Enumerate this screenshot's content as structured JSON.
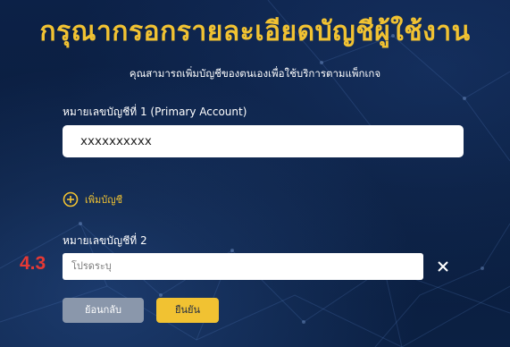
{
  "form": {
    "title": "กรุณากรอกรายละเอียดบัญชีผู้ใช้งาน",
    "subtitle": "คุณสามารถเพิ่มบัญชีของตนเองเพื่อใช้บริการตามแพ็กเกจ",
    "account1": {
      "label": "หมายเลขบัญชีที่ 1 (Primary Account)",
      "value": "xxxxxxxxxx"
    },
    "add_account_label": "เพิ่มบัญชี",
    "account2": {
      "step_marker": "4.3",
      "label": "หมายเลขบัญชีที่ 2",
      "placeholder": "โปรดระบุ"
    },
    "buttons": {
      "back": "ย้อนกลับ",
      "confirm": "ยืนยัน"
    }
  },
  "icons": {
    "add": "plus-circle-icon",
    "remove": "close-icon"
  },
  "colors": {
    "background": "#0b1e3f",
    "accent": "#f1c232",
    "step_marker": "#e53935",
    "back_button": "#8a97ab"
  }
}
